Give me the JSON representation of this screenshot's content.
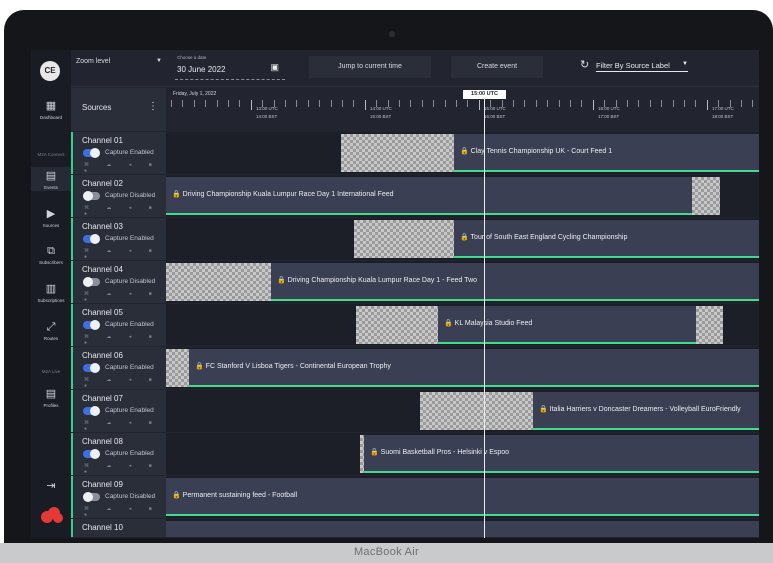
{
  "device_label": "MacBook Air",
  "sidebar": {
    "avatar": "CE",
    "items": [
      {
        "label": "Dashboard",
        "icon": "dashboard-icon",
        "glyph": "▦"
      },
      {
        "label": "Events",
        "icon": "calendar-icon",
        "glyph": "▤"
      },
      {
        "label": "Sources",
        "icon": "play-icon",
        "glyph": "▶"
      },
      {
        "label": "Subscribers",
        "icon": "subscribers-icon",
        "glyph": "⧉"
      },
      {
        "label": "Subscriptions",
        "icon": "subscriptions-icon",
        "glyph": "▥"
      },
      {
        "label": "Routes",
        "icon": "routes-icon",
        "glyph": "⤢"
      },
      {
        "label": "Profiles",
        "icon": "document-icon",
        "glyph": "▤"
      }
    ],
    "sections": [
      "M2A Connect",
      "M2A Live"
    ],
    "logout_glyph": "⇥"
  },
  "topbar": {
    "zoom_label": "Zoom level",
    "date_caption": "Choose a date",
    "date_value": "30 June 2022",
    "jump_label": "Jump to current time",
    "create_label": "Create event",
    "filter_label": "Filter By Source Label"
  },
  "sources_header": "Sources",
  "timeline": {
    "day_label": "Friday, July 1, 2022",
    "current_time": "15:00 UTC",
    "labels": [
      {
        "utc": "13:00 UTC",
        "bst": "14:00 BST"
      },
      {
        "utc": "14:00 UTC",
        "bst": "15:00 BST"
      },
      {
        "utc": "15:00 UTC",
        "bst": "16:00 BST"
      },
      {
        "utc": "16:00 UTC",
        "bst": "17:00 BST"
      },
      {
        "utc": "17:00 UTC",
        "bst": "18:00 BST"
      }
    ]
  },
  "channels": [
    {
      "name": "Channel 01",
      "capture": "Capture Enabled",
      "enabled": true,
      "event": "Clay Tennis Championship UK - Court Feed 1"
    },
    {
      "name": "Channel 02",
      "capture": "Capture Disabled",
      "enabled": false,
      "event": "Driving Championship Kuala Lumpur Race Day 1 International Feed"
    },
    {
      "name": "Channel 03",
      "capture": "Capture Enabled",
      "enabled": true,
      "event": "Tour of South East England Cycling Championship"
    },
    {
      "name": "Channel 04",
      "capture": "Capture Disabled",
      "enabled": false,
      "event": "Driving Championship Kuala Lumpur Race Day 1 - Feed Two"
    },
    {
      "name": "Channel 05",
      "capture": "Capture Enabled",
      "enabled": true,
      "event": "KL Malaysia Studio Feed"
    },
    {
      "name": "Channel 06",
      "capture": "Capture Enabled",
      "enabled": true,
      "event": "FC Stanford V Lisboa Tigers - Continental European Trophy"
    },
    {
      "name": "Channel 07",
      "capture": "Capture Enabled",
      "enabled": true,
      "event": "Italia Harriers v Doncaster Dreamers - Volleyball EuroFriendly"
    },
    {
      "name": "Channel 08",
      "capture": "Capture Enabled",
      "enabled": true,
      "event": "Suomi Basketball Pros - Helsinki v Espoo"
    },
    {
      "name": "Channel 09",
      "capture": "Capture Disabled",
      "enabled": false,
      "event": "Permanent sustaining feed - Football"
    },
    {
      "name": "Channel 10",
      "capture": "",
      "enabled": true,
      "event": ""
    }
  ],
  "channel_icons": "⌘ ☁ ◂ ■ ●",
  "lock_glyph": "🔒",
  "colors": {
    "accent": "#3ddc8f",
    "toggle_on": "#3d6fe0",
    "event_bg": "#3b3f53"
  }
}
